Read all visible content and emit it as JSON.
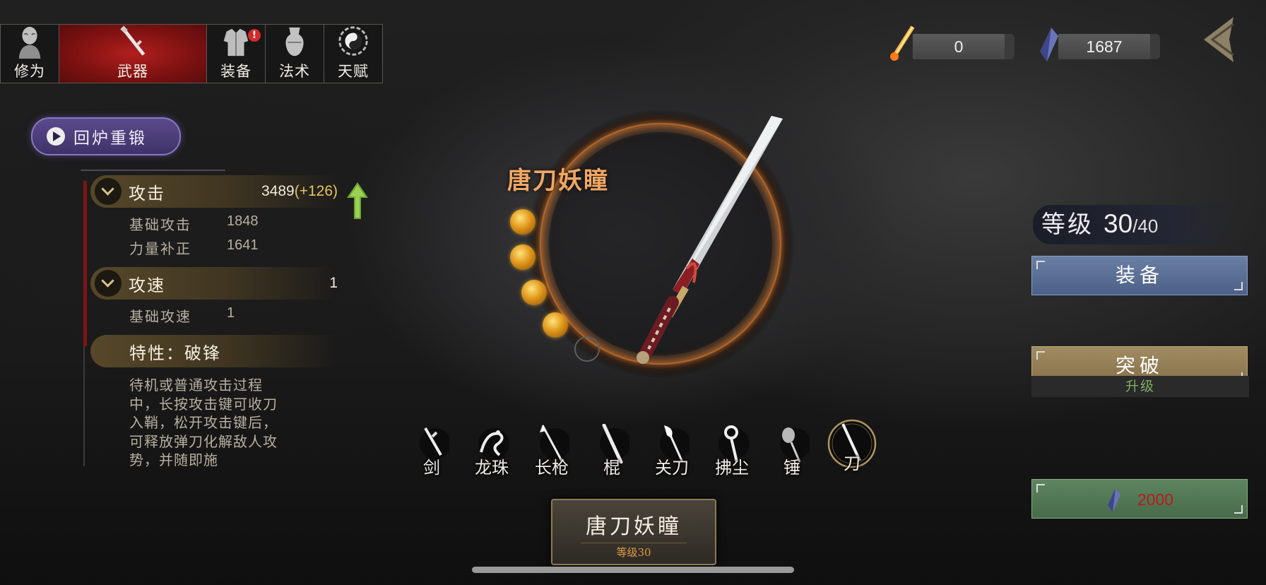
{
  "tabs": [
    {
      "label": "修为",
      "icon": "cultivation-figure-icon",
      "active": false
    },
    {
      "label": "武器",
      "icon": "sword-icon",
      "active": true
    },
    {
      "label": "装备",
      "icon": "armor-icon",
      "active": false,
      "badge": "!"
    },
    {
      "label": "法术",
      "icon": "spell-gourd-icon",
      "active": false
    },
    {
      "label": "天赋",
      "icon": "yin-yang-icon",
      "active": false
    }
  ],
  "currency": {
    "fire_blade": {
      "icon": "flaming-blade-icon",
      "value": "0"
    },
    "crystal": {
      "icon": "blue-crystal-icon",
      "value": "1687"
    }
  },
  "reforge_label": "回炉重锻",
  "stats": {
    "attack": {
      "name": "攻击",
      "value": "3489",
      "bonus": "(+126)",
      "subs": [
        {
          "name": "基础攻击",
          "value": "1848"
        },
        {
          "name": "力量补正",
          "value": "1641"
        }
      ]
    },
    "speed": {
      "name": "攻速",
      "value": "1",
      "subs": [
        {
          "name": "基础攻速",
          "value": "1"
        }
      ]
    },
    "trait": {
      "name": "特性：破锋",
      "desc": "待机或普通攻击过程中，长按攻击键可收刀入鞘，松开攻击键后，可释放弹刀化解敌人攻势，并随即施"
    }
  },
  "weapon": {
    "name": "唐刀妖瞳",
    "plate_name": "唐刀妖瞳",
    "plate_level": "等级30",
    "gems_filled": 4,
    "gems_total": 5
  },
  "weapon_types": [
    {
      "label": "剑",
      "icon": "sword-type-icon",
      "selected": false
    },
    {
      "label": "龙珠",
      "icon": "dragon-orb-icon",
      "selected": false
    },
    {
      "label": "长枪",
      "icon": "spear-icon",
      "selected": false
    },
    {
      "label": "棍",
      "icon": "staff-icon",
      "selected": false
    },
    {
      "label": "关刀",
      "icon": "guandao-icon",
      "selected": false
    },
    {
      "label": "拂尘",
      "icon": "whisk-icon",
      "selected": false
    },
    {
      "label": "锤",
      "icon": "hammer-icon",
      "selected": false
    },
    {
      "label": "刀",
      "icon": "saber-icon",
      "selected": true
    }
  ],
  "level": {
    "label": "等级",
    "current": "30",
    "max": "/40"
  },
  "buttons": {
    "equip": "装备",
    "breakthrough": "突破",
    "upgrade_label": "升级",
    "upgrade_cost": "2000"
  },
  "colors": {
    "active_tab": "#a81a1a",
    "weapon_name": "#f1a764",
    "equip_btn": "#5a6f96",
    "break_btn": "#927d55",
    "upgrade_btn": "#537854",
    "cost": "#b81c1c"
  }
}
